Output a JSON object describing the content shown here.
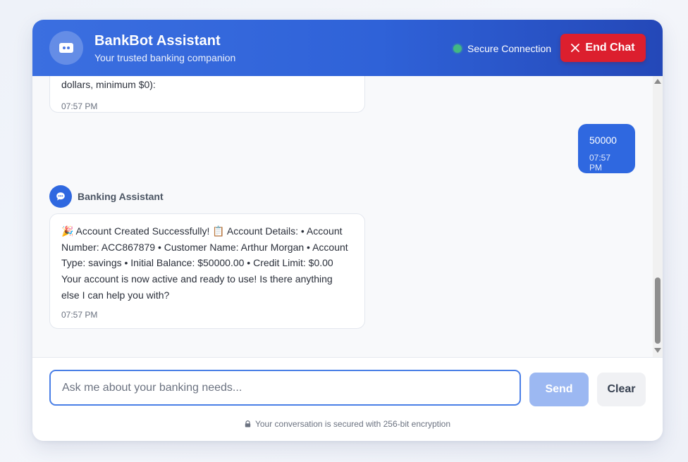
{
  "header": {
    "title": "BankBot Assistant",
    "subtitle": "Your trusted banking companion",
    "status_text": "Secure Connection",
    "end_chat_label": "End Chat",
    "colors": {
      "gradient_start": "#3b6fe0",
      "gradient_end": "#2448b8",
      "status_dot": "#42b883",
      "end_chat": "#dc1f2e"
    }
  },
  "messages": [
    {
      "sender": "bot",
      "text": "dollars, minimum $0):",
      "time": "07:57 PM"
    },
    {
      "sender": "user",
      "text": "50000",
      "time": "07:57 PM"
    },
    {
      "sender": "bot",
      "sender_label": "Banking Assistant",
      "text": "🎉 Account Created Successfully! 📋 Account Details: • Account Number: ACC867879 • Customer Name: Arthur Morgan • Account Type: savings • Initial Balance: $50000.00 • Credit Limit: $0.00 Your account is now active and ready to use! Is there anything else I can help you with?",
      "time": "07:57 PM"
    }
  ],
  "composer": {
    "placeholder": "Ask me about your banking needs...",
    "value": "",
    "send_label": "Send",
    "clear_label": "Clear",
    "security_note": "Your conversation is secured with 256-bit encryption"
  },
  "icons": {
    "logo": "wallet-icon",
    "assistant_avatar": "chat-bubble-icon",
    "end_chat": "close-icon",
    "security_note": "lock-icon"
  }
}
